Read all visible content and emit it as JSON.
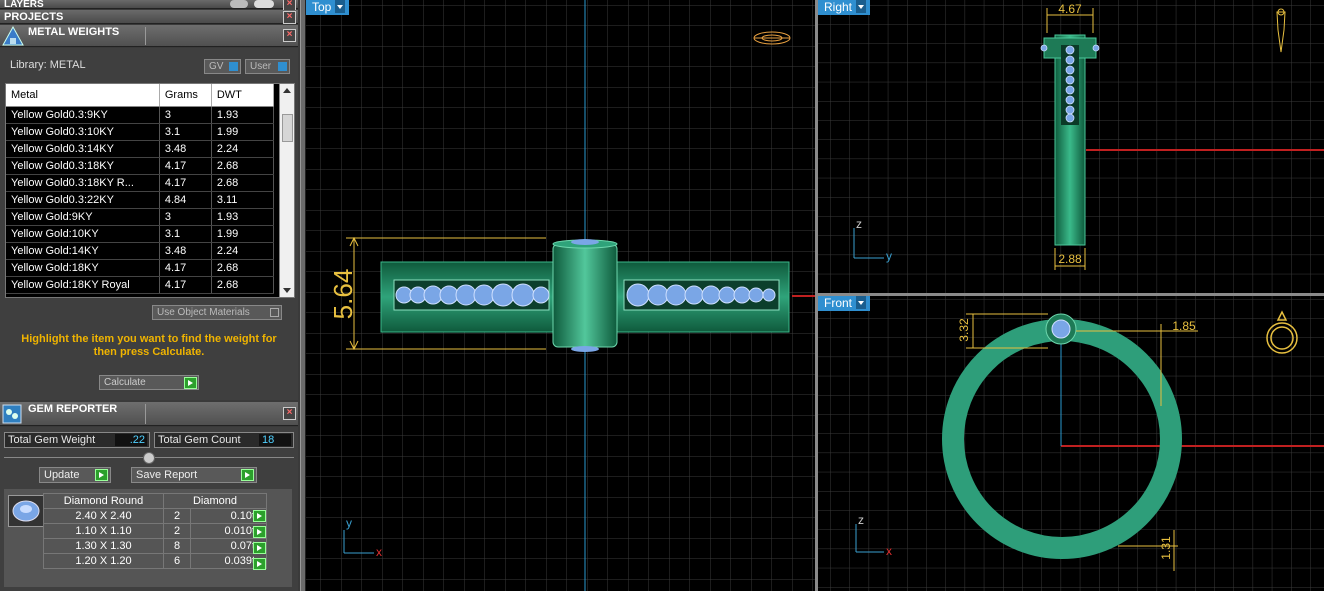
{
  "layers_title": "LAYERS",
  "projects_title": "PROJECTS",
  "metal_weights": {
    "title": "METAL WEIGHTS",
    "library_label": "Library: METAL",
    "gv_label": "GV",
    "user_label": "User",
    "columns": [
      "Metal",
      "Grams",
      "DWT"
    ],
    "rows": [
      [
        "Yellow Gold0.3:9KY",
        "3",
        "1.93"
      ],
      [
        "Yellow Gold0.3:10KY",
        "3.1",
        "1.99"
      ],
      [
        "Yellow Gold0.3:14KY",
        "3.48",
        "2.24"
      ],
      [
        "Yellow Gold0.3:18KY",
        "4.17",
        "2.68"
      ],
      [
        "Yellow Gold0.3:18KY R...",
        "4.17",
        "2.68"
      ],
      [
        "Yellow Gold0.3:22KY",
        "4.84",
        "3.11"
      ],
      [
        "Yellow Gold:9KY",
        "3",
        "1.93"
      ],
      [
        "Yellow Gold:10KY",
        "3.1",
        "1.99"
      ],
      [
        "Yellow Gold:14KY",
        "3.48",
        "2.24"
      ],
      [
        "Yellow Gold:18KY",
        "4.17",
        "2.68"
      ],
      [
        "Yellow Gold:18KY Royal",
        "4.17",
        "2.68"
      ]
    ],
    "use_object_materials": "Use Object Materials",
    "hint": "Highlight the item you want to find the weight for then press Calculate.",
    "calculate_label": "Calculate"
  },
  "gem_reporter": {
    "title": "GEM REPORTER",
    "total_weight_label": "Total Gem Weight",
    "total_weight_value": ".22",
    "total_count_label": "Total Gem Count",
    "total_count_value": "18",
    "update_label": "Update",
    "save_report_label": "Save Report",
    "gem_type": "Diamond Round",
    "gem_material": "Diamond",
    "gems": [
      {
        "size": "2.40 X 2.40",
        "count": "2",
        "weight": "0.10tw"
      },
      {
        "size": "1.10 X 1.10",
        "count": "2",
        "weight": "0.010tw"
      },
      {
        "size": "1.30 X 1.30",
        "count": "8",
        "weight": "0.07tw"
      },
      {
        "size": "1.20 X 1.20",
        "count": "6",
        "weight": "0.039tw"
      }
    ]
  },
  "viewports": {
    "top": {
      "label": "Top",
      "dim": "5.64",
      "axis_v": "y",
      "axis_h": "x"
    },
    "right": {
      "label": "Right",
      "dim_top": "4.67",
      "dim_bottom": "2.88",
      "axis_v": "z",
      "axis_h": "y"
    },
    "front": {
      "label": "Front",
      "dim_left": "3.32",
      "dim_right": "1.85",
      "dim_bottom": "1.31",
      "axis_v": "z",
      "axis_h": "x"
    }
  },
  "colors": {
    "accent": "#2f8fd0",
    "ring": "#2e9e7a",
    "gem": "#7aa6e6",
    "dimension": "#e8c040",
    "hint": "#f0b400"
  }
}
